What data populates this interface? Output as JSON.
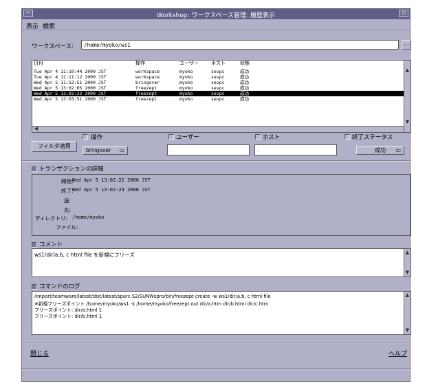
{
  "window": {
    "title": "Workshop: ワークスペース管理: 履歴表示",
    "menu_icon": "window-menu-icon",
    "minimize_icon": "minimize-icon"
  },
  "menu": [
    "表示",
    "検索"
  ],
  "workspace": {
    "label": "ワークスペース:",
    "value": "/home/myoko/ws1",
    "browse_label": "..."
  },
  "history_table": {
    "columns": [
      "日付",
      "操作",
      "ユーザー",
      "ホスト",
      "状態"
    ],
    "rows": [
      {
        "date": "Tue Apr  4 11:10:44 2000 JST",
        "op": "workspace",
        "user": "myoko",
        "host": "sevpc",
        "status": "成功",
        "selected": false
      },
      {
        "date": "Tue Apr  4 11:11:12 2000 JST",
        "op": "workspace",
        "user": "myoko",
        "host": "sevpc",
        "status": "成功",
        "selected": false
      },
      {
        "date": "Wed Apr  5 11:12:51 2000 JST",
        "op": "bringover",
        "user": "myoko",
        "host": "sevpc",
        "status": "成功",
        "selected": false
      },
      {
        "date": "Wed Apr  5 13:02:05 2000 JST",
        "op": "freezept",
        "user": "myoko",
        "host": "sevpc",
        "status": "成功",
        "selected": false
      },
      {
        "date": "Wed Apr  5 13:02:22 2000 JST",
        "op": "freezept",
        "user": "myoko",
        "host": "sevpc",
        "status": "成功",
        "selected": true
      },
      {
        "date": "Wed Apr  5 13:03:51 2000 JST",
        "op": "freezept",
        "user": "myoko",
        "host": "sevpc",
        "status": "成功",
        "selected": false
      }
    ]
  },
  "filter": {
    "button_label": "フィルタ適用",
    "op_label": "操作",
    "op_value": "bringover",
    "user_label": "ユーザー",
    "user_value": ".",
    "host_label": "ホスト",
    "host_value": ".",
    "status_label": "終了ステータス",
    "status_value": "成功"
  },
  "transaction": {
    "header": "トランザクションの詳細",
    "start_label": "開始:",
    "start_value": "Wed Apr  5 13:02:22 2000 JST",
    "end_label": "終了:",
    "end_value": "Wed Apr  5 13:02:24 2000 JST",
    "from_label": "送:",
    "to_label": "先:",
    "dir_label": "ディレクトリ:",
    "dir_value": "/home/myoko",
    "files_label": "ファイル:"
  },
  "comment": {
    "header": "コメント",
    "text": "ws1/dir/a.b, c html file を新規にフリーズ"
  },
  "command_log": {
    "header": "コマンドのログ",
    "lines": [
      "/import/teamware/latest/dist/latest/sparc-S2/SUNWspro/bin/freezept create -w ws1/dir/a.b, c html file",
      "※新規フリーズポイント /home/myoko/ws1 -k /home/myoko/freezept.out dir/a.htm dir/b.html dir/c.htm",
      "フリーズポイント: dir/a.html 1",
      "フリーズポイント: dir/b.html 1"
    ]
  },
  "footer": {
    "close_label": "閉じる",
    "help_label": "ヘルプ"
  }
}
